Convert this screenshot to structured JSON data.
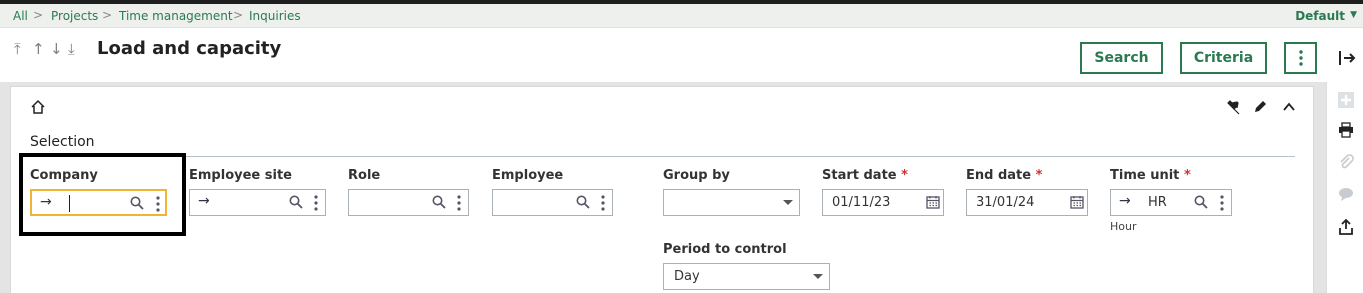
{
  "breadcrumb": {
    "items": [
      "All",
      "Projects",
      "Time management",
      "Inquiries"
    ],
    "separator": ">"
  },
  "profile": {
    "label": "Default"
  },
  "header": {
    "nav_icons": [
      "first-record-icon",
      "previous-record-icon",
      "next-record-icon",
      "last-record-icon"
    ],
    "title": "Load and capacity",
    "search_label": "Search",
    "criteria_label": "Criteria",
    "more_icon": "vertical-dots-icon",
    "exit_icon": "exit-icon"
  },
  "panel": {
    "section_title": "Selection",
    "tool_icons": [
      "pin-icon",
      "pencil-icon",
      "chevron-up-icon"
    ]
  },
  "fields": {
    "company": {
      "label": "Company",
      "value": ""
    },
    "employee_site": {
      "label": "Employee site",
      "value": ""
    },
    "role": {
      "label": "Role",
      "value": ""
    },
    "employee": {
      "label": "Employee",
      "value": ""
    },
    "group_by": {
      "label": "Group by",
      "value": ""
    },
    "start_date": {
      "label": "Start date",
      "required": "*",
      "value": "01/11/23"
    },
    "end_date": {
      "label": "End date",
      "required": "*",
      "value": "31/01/24"
    },
    "time_unit": {
      "label": "Time unit",
      "required": "*",
      "value": "HR",
      "description": "Hour"
    },
    "period_to_control": {
      "label": "Period to control",
      "value": "Day"
    }
  },
  "sidebar": {
    "icons": [
      "plus-icon",
      "printer-icon",
      "paperclip-icon",
      "comment-icon",
      "export-icon"
    ]
  },
  "colors": {
    "accent": "#2a7a50",
    "focus_border": "#f2b233",
    "required": "#d0312d",
    "highlight_frame": "#000000"
  }
}
